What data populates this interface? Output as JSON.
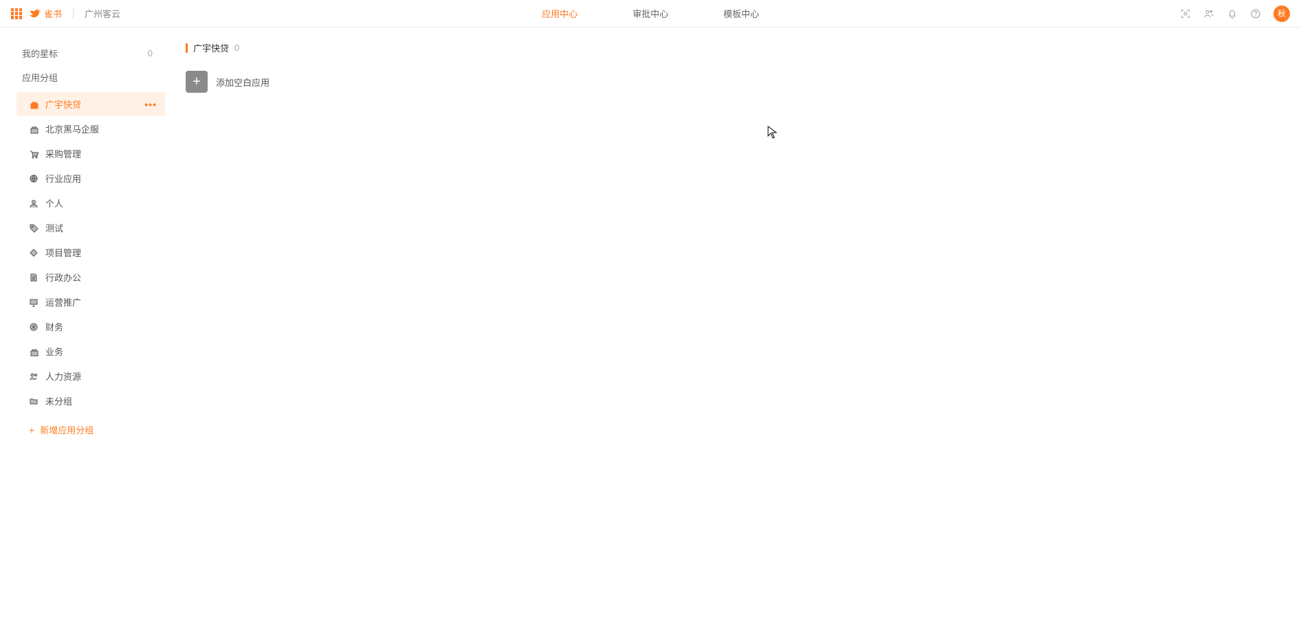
{
  "header": {
    "brand": "雀书",
    "org": "广州客云",
    "nav": {
      "app_center": "应用中心",
      "approval_center": "审批中心",
      "template_center": "模板中心"
    },
    "avatar_text": "秋"
  },
  "sidebar": {
    "star_label": "我的星标",
    "star_count": "0",
    "group_header": "应用分组",
    "items": [
      {
        "label": "广宇快贷",
        "icon": "briefcase",
        "active": true
      },
      {
        "label": "北京黑马企服",
        "icon": "briefcase",
        "active": false
      },
      {
        "label": "采购管理",
        "icon": "cart",
        "active": false
      },
      {
        "label": "行业应用",
        "icon": "globe",
        "active": false
      },
      {
        "label": "个人",
        "icon": "user",
        "active": false
      },
      {
        "label": "测试",
        "icon": "tag",
        "active": false
      },
      {
        "label": "项目管理",
        "icon": "diamond",
        "active": false
      },
      {
        "label": "行政办公",
        "icon": "doc",
        "active": false
      },
      {
        "label": "运营推广",
        "icon": "screen",
        "active": false
      },
      {
        "label": "财务",
        "icon": "coin",
        "active": false
      },
      {
        "label": "业务",
        "icon": "briefcase",
        "active": false
      },
      {
        "label": "人力资源",
        "icon": "people",
        "active": false
      },
      {
        "label": "未分组",
        "icon": "folder",
        "active": false
      }
    ],
    "add_group_label": "新增应用分组"
  },
  "main": {
    "title": "广宇快贷",
    "count": "0",
    "add_app_label": "添加空白应用"
  }
}
